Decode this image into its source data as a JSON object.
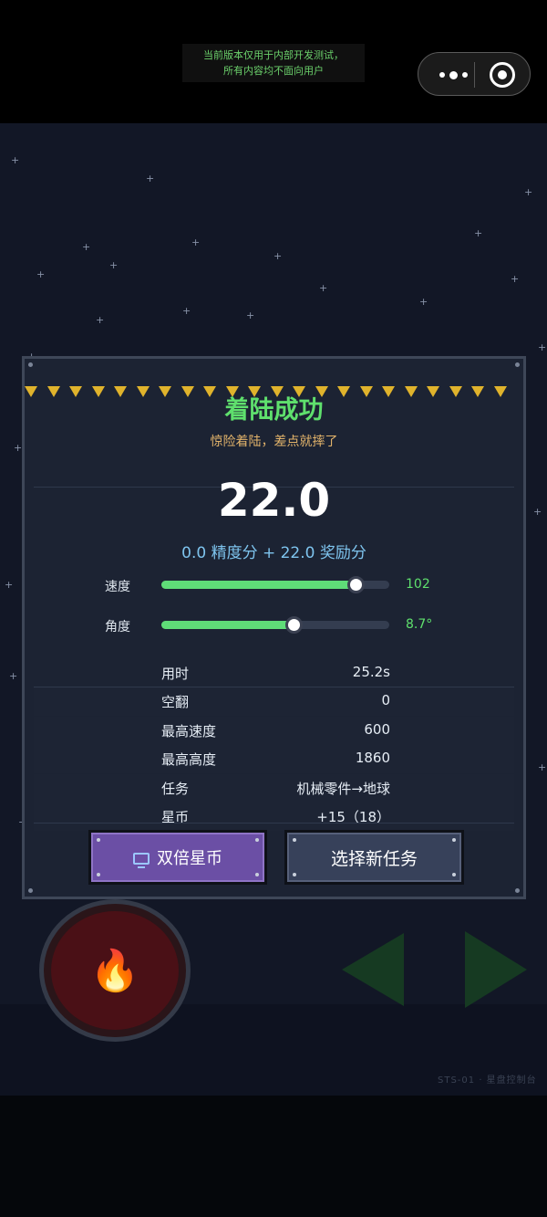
{
  "dev_notice": {
    "line1": "当前版本仅用于内部开发测试，",
    "line2": "所有内容均不面向用户"
  },
  "capsule": {
    "more_icon": "more-dots-icon",
    "close_icon": "target-circle-icon"
  },
  "result": {
    "title": "着陆成功",
    "subtitle": "惊险着陆，差点就摔了",
    "score": "22.0",
    "score_breakdown": "0.0 精度分 + 22.0 奖励分"
  },
  "meters": {
    "speed": {
      "label": "速度",
      "value": "102",
      "fill_fraction": 0.85
    },
    "angle": {
      "label": "角度",
      "value": "8.7°",
      "fill_fraction": 0.58
    }
  },
  "stats": [
    {
      "label": "用时",
      "value": "25.2s"
    },
    {
      "label": "空翻",
      "value": "0"
    },
    {
      "label": "最高速度",
      "value": "600"
    },
    {
      "label": "最高高度",
      "value": "1860"
    },
    {
      "label": "任务",
      "value": "机械零件→地球"
    },
    {
      "label": "星币",
      "value": "+15（18）"
    }
  ],
  "buttons": {
    "double_coins": "双倍星币",
    "new_mission": "选择新任务"
  },
  "controls": {
    "thrust_icon": "fire-icon",
    "left_icon": "arrow-left-icon",
    "right_icon": "arrow-right-icon"
  },
  "footer_code": "STS-01 · 星盘控制台",
  "colors": {
    "accent_green": "#5fe06d",
    "subtitle_gold": "#e3b46b",
    "score_blue": "#7ec4ee",
    "purple_button": "#6b4fa5"
  }
}
